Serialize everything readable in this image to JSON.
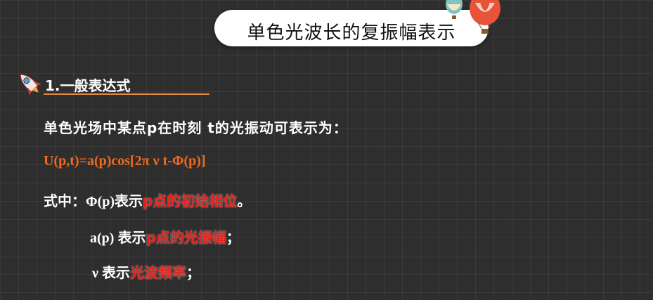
{
  "title": "单色光波长的复振幅表示",
  "section": {
    "heading": "1.一般表达式"
  },
  "intro": "单色光场中某点p在时刻 t的光振动可表示为：",
  "formula": "U(p,t)=a(p)cos[2π ν t-Φ(p)]",
  "definitions": [
    {
      "prefix": "式中：",
      "symbol": "Φ(p)",
      "verb": "表示",
      "highlight": "p点的初始相位",
      "suffix": "。"
    },
    {
      "prefix": "",
      "symbol": "a(p) ",
      "verb": "表示",
      "highlight": "p点的光振幅",
      "suffix": "；"
    },
    {
      "prefix": "",
      "symbol": "ν ",
      "verb": "表示",
      "highlight": "光波频率",
      "suffix": "；"
    }
  ],
  "colors": {
    "formula": "#f06a1e",
    "highlight": "#e8201a",
    "underline": "#e08a3c",
    "background": "#2e2e2e"
  },
  "icons": [
    "hot-air-balloon-icon",
    "rocket-icon"
  ]
}
